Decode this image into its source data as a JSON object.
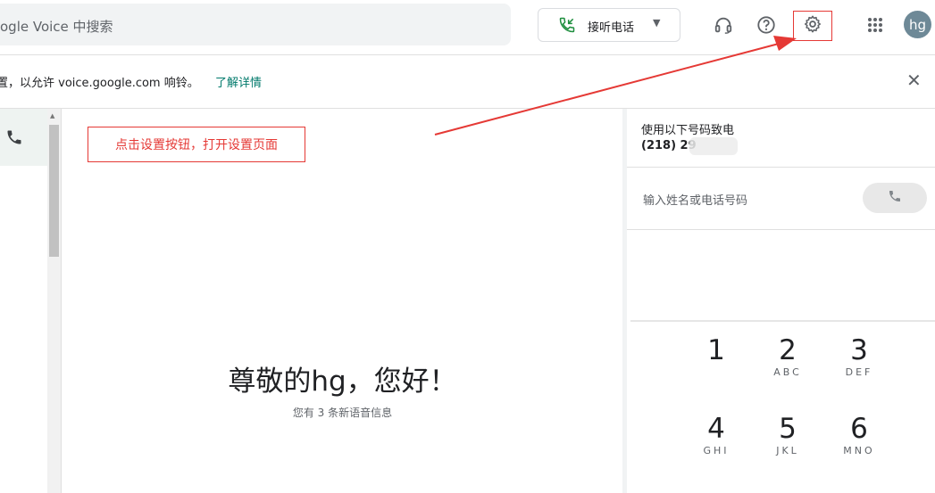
{
  "search": {
    "placeholder": "ogle Voice 中搜索"
  },
  "header": {
    "answer_button_label": "接听电话",
    "avatar_initials": "hg"
  },
  "banner": {
    "message": "置，以允许 voice.google.com 响铃。",
    "link": "了解详情"
  },
  "annotation": {
    "callout_text": "点击设置按钮，打开设置页面"
  },
  "main": {
    "greeting": "尊敬的hg，您好！",
    "subtitle": "您有 3 条新语音信息"
  },
  "dialer": {
    "from_label": "使用以下号码致电",
    "from_number": "(218) 29",
    "input_placeholder": "输入姓名或电话号码",
    "keys": [
      {
        "digit": "1",
        "letters": ""
      },
      {
        "digit": "2",
        "letters": "ABC"
      },
      {
        "digit": "3",
        "letters": "DEF"
      },
      {
        "digit": "4",
        "letters": "GHI"
      },
      {
        "digit": "5",
        "letters": "JKL"
      },
      {
        "digit": "6",
        "letters": "MNO"
      }
    ]
  },
  "colors": {
    "accent": "#00796b",
    "annotation": "#e53935",
    "avatar": "#6e8997"
  },
  "icons": [
    "phone-answer-icon",
    "headset-icon",
    "help-icon",
    "gear-icon",
    "apps-grid-icon",
    "close-icon",
    "phone-icon"
  ]
}
